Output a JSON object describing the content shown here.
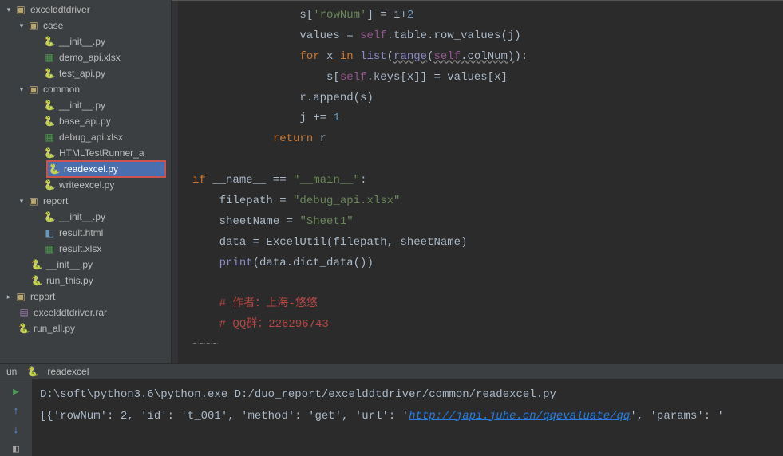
{
  "tree": {
    "root": {
      "label": "excelddtdriver"
    },
    "case": {
      "label": "case",
      "items": [
        "__init__.py",
        "demo_api.xlsx",
        "test_api.py"
      ]
    },
    "common": {
      "label": "common",
      "items": [
        "__init__.py",
        "base_api.py",
        "debug_api.xlsx",
        "HTMLTestRunner_a",
        "readexcel.py",
        "writeexcel.py"
      ]
    },
    "report": {
      "label": "report",
      "items": [
        "__init__.py",
        "result.html",
        "result.xlsx"
      ]
    },
    "root_files": [
      "__init__.py",
      "run_this.py"
    ],
    "report2": "report",
    "root_files2": [
      "excelddtdriver.rar",
      "run_all.py"
    ]
  },
  "selected_file": "readexcel.py",
  "code": {
    "l1a": "s[",
    "l1b": "'rowNum'",
    "l1c": "] = i+",
    "l1d": "2",
    "l2a": "values = ",
    "l2b": "self",
    "l2c": ".table.row_values(j)",
    "l3a": "for ",
    "l3b": "x ",
    "l3c": "in ",
    "l3d": "list",
    "l3e": "(",
    "l3f": "range",
    "l3g": "(",
    "l3h": "self",
    "l3i": ".colNum)",
    "l3j": "):",
    "l4a": "s[",
    "l4b": "self",
    "l4c": ".keys[x]] = values[x]",
    "l5a": "r.append(s)",
    "l6a": "j += ",
    "l6b": "1",
    "l7a": "return ",
    "l7b": "r",
    "l9a": "if ",
    "l9b": "__name__ == ",
    "l9c": "\"__main__\"",
    "l9d": ":",
    "l10a": "filepath = ",
    "l10b": "\"debug_api.xlsx\"",
    "l11a": "sheetName = ",
    "l11b": "\"Sheet1\"",
    "l12a": "data = ExcelUtil(filepath",
    "l12b": ", ",
    "l12c": "sheetName)",
    "l13a": "print",
    "l13b": "(data.dict_data())",
    "c1": "# 作者：上海-悠悠",
    "c2": "# QQ群：226296743"
  },
  "tabs": {
    "left": "un",
    "icon_label": "readexcel"
  },
  "console": {
    "cmd": "D:\\soft\\python3.6\\python.exe D:/duo_report/excelddtdriver/common/readexcel.py",
    "out_pre": "[{'rowNum': 2, 'id': 't_001', 'method': 'get', 'url': '",
    "out_url": "http://japi.juhe.cn/qqevaluate/qq",
    "out_post": "', 'params': '"
  }
}
